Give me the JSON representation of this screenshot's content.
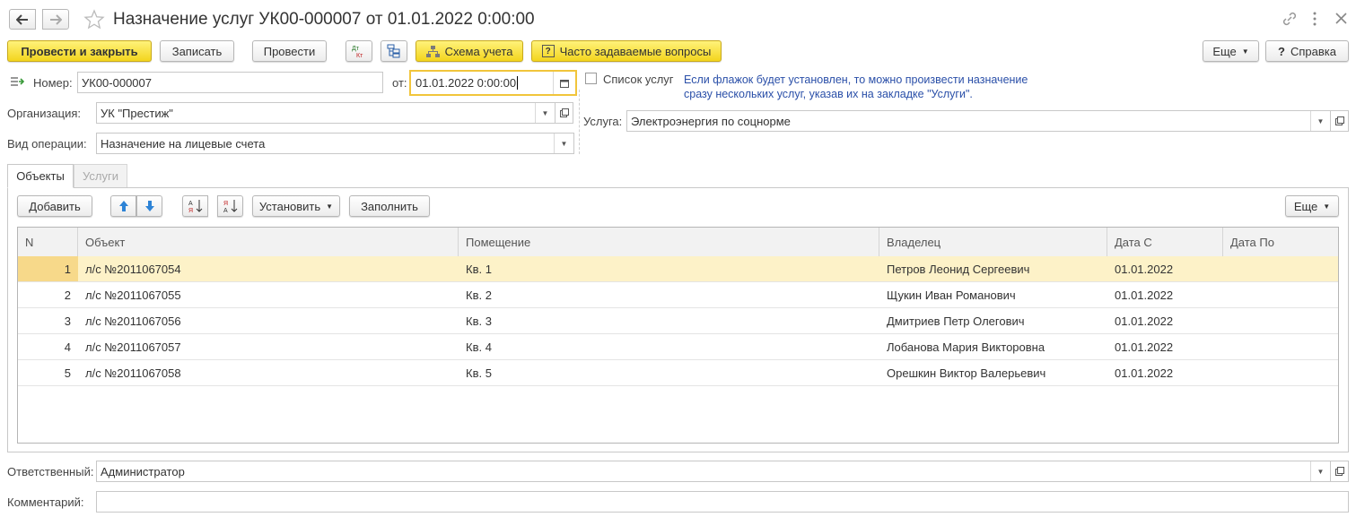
{
  "window": {
    "title": "Назначение услуг УК00-000007 от 01.01.2022 0:00:00"
  },
  "toolbar": {
    "post_close": "Провести и закрыть",
    "save": "Записать",
    "post": "Провести",
    "dt_kt": "Дт Кт",
    "scheme": "Схема учета",
    "faq": "Часто задаваемые вопросы",
    "more": "Еще",
    "help": "Справка"
  },
  "form": {
    "number_label": "Номер:",
    "number_value": "УК00-000007",
    "date_label": "от:",
    "date_value": "01.01.2022  0:00:00",
    "service_list_label": "Список услуг",
    "service_list_hint": "Если флажок будет установлен, то можно произвести назначение сразу нескольких услуг, указав их на закладке \"Услуги\".",
    "org_label": "Организация:",
    "org_value": "УК \"Престиж\"",
    "op_label": "Вид операции:",
    "op_value": "Назначение на лицевые счета",
    "service_label": "Услуга:",
    "service_value": "Электроэнергия по соцнорме",
    "responsible_label": "Ответственный:",
    "responsible_value": "Администратор",
    "comment_label": "Комментарий:",
    "comment_value": ""
  },
  "tabs": [
    "Объекты",
    "Услуги"
  ],
  "table_toolbar": {
    "add": "Добавить",
    "set": "Установить",
    "fill": "Заполнить",
    "more": "Еще"
  },
  "table": {
    "columns": [
      "N",
      "Объект",
      "Помещение",
      "Владелец",
      "Дата С",
      "Дата По"
    ],
    "rows": [
      {
        "n": "1",
        "object": "л/с №2011067054",
        "room": "Кв. 1",
        "owner": "Петров Леонид Сергеевич",
        "date_from": "01.01.2022",
        "date_to": ""
      },
      {
        "n": "2",
        "object": "л/с №2011067055",
        "room": "Кв. 2",
        "owner": "Щукин Иван Романович",
        "date_from": "01.01.2022",
        "date_to": ""
      },
      {
        "n": "3",
        "object": "л/с №2011067056",
        "room": "Кв. 3",
        "owner": "Дмитриев Петр Олегович",
        "date_from": "01.01.2022",
        "date_to": ""
      },
      {
        "n": "4",
        "object": "л/с №2011067057",
        "room": "Кв. 4",
        "owner": "Лобанова Мария Викторовна",
        "date_from": "01.01.2022",
        "date_to": ""
      },
      {
        "n": "5",
        "object": "л/с №2011067058",
        "room": "Кв. 5",
        "owner": "Орешкин Виктор Валерьевич",
        "date_from": "01.01.2022",
        "date_to": ""
      }
    ]
  },
  "colors": {
    "accent_yellow": "#f3d51e",
    "selected_row": "#fdf2c8",
    "hint_blue": "#2a4fa8"
  }
}
